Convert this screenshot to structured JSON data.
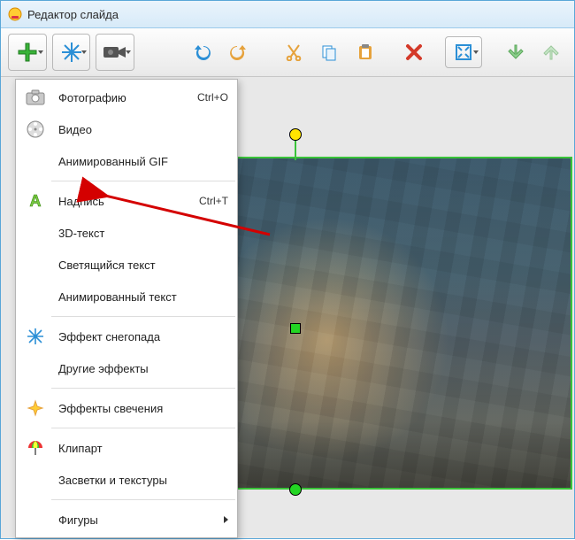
{
  "window": {
    "title": "Редактор слайда"
  },
  "toolbar": {
    "add": "add",
    "effects": "effects",
    "camera": "camera",
    "undo": "undo",
    "redo": "redo",
    "cut": "cut",
    "copy": "copy",
    "paste": "paste",
    "delete": "delete",
    "fullscreen": "fullscreen",
    "move_down": "move-down",
    "move_up": "move-up"
  },
  "menu": {
    "items": [
      {
        "label": "Фотографию",
        "shortcut": "Ctrl+O",
        "icon": "camera-photo"
      },
      {
        "label": "Видео",
        "shortcut": "",
        "icon": "film-reel"
      },
      {
        "label": "Анимированный GIF",
        "shortcut": "",
        "icon": ""
      },
      {
        "label": "Надпись",
        "shortcut": "Ctrl+T",
        "icon": "text-A"
      },
      {
        "label": "3D-текст",
        "shortcut": "",
        "icon": ""
      },
      {
        "label": "Светящийся текст",
        "shortcut": "",
        "icon": ""
      },
      {
        "label": "Анимированный текст",
        "shortcut": "",
        "icon": ""
      },
      {
        "label": "Эффект снегопада",
        "shortcut": "",
        "icon": "snowflake"
      },
      {
        "label": "Другие эффекты",
        "shortcut": "",
        "icon": ""
      },
      {
        "label": "Эффекты свечения",
        "shortcut": "",
        "icon": "sparkle"
      },
      {
        "label": "Клипарт",
        "shortcut": "",
        "icon": "umbrella"
      },
      {
        "label": "Засветки и текстуры",
        "shortcut": "",
        "icon": ""
      },
      {
        "label": "Фигуры",
        "shortcut": "",
        "icon": "",
        "submenu": true
      }
    ]
  },
  "annotation": {
    "color": "#d40000"
  }
}
